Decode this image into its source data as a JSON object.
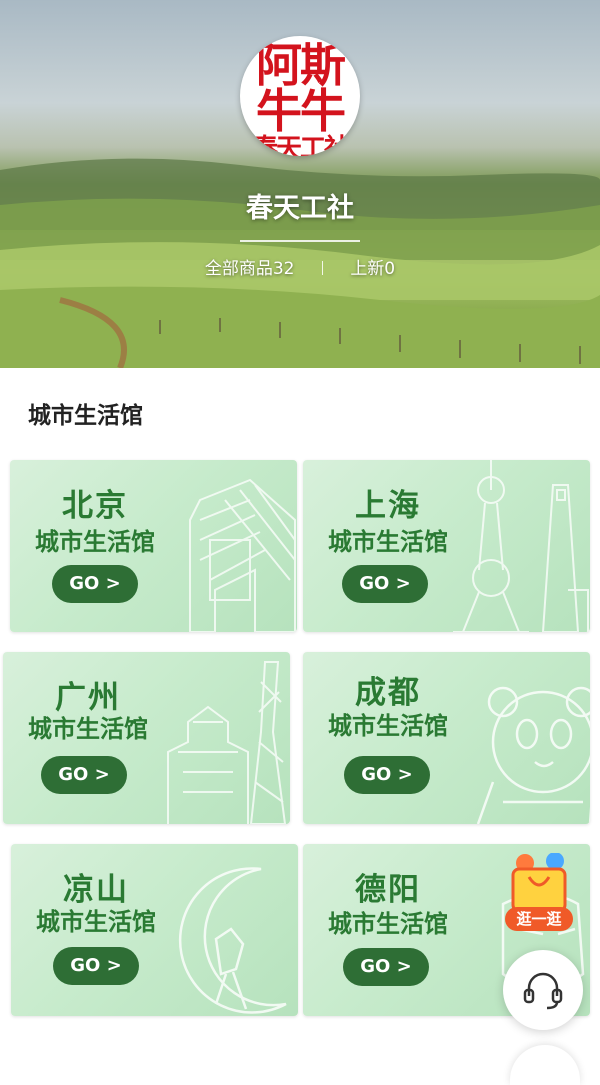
{
  "shop": {
    "logo_lines": [
      "阿斯",
      "牛牛",
      "春天工社"
    ],
    "name": "春天工社",
    "all_products": "全部商品32",
    "new_arrivals": "上新0"
  },
  "section": {
    "title": "城市生活馆"
  },
  "cards": [
    {
      "city": "北京",
      "sub": "城市生活馆",
      "go": "GO >"
    },
    {
      "city": "上海",
      "sub": "城市生活馆",
      "go": "GO >"
    },
    {
      "city": "广州",
      "sub": "城市生活馆",
      "go": "GO >"
    },
    {
      "city": "成都",
      "sub": "城市生活馆",
      "go": "GO >"
    },
    {
      "city": "凉山",
      "sub": "城市生活馆",
      "go": "GO >"
    },
    {
      "city": "德阳",
      "sub": "城市生活馆",
      "go": "GO >"
    }
  ],
  "floating": {
    "shop_label": "逛一逛"
  },
  "colors": {
    "brand_green": "#2e6e35",
    "text_green": "#2a7a33",
    "logo_red": "#d3131d",
    "badge_orange": "#f05a28"
  },
  "icons": [
    "shopping-bag-icon",
    "headset-icon"
  ]
}
